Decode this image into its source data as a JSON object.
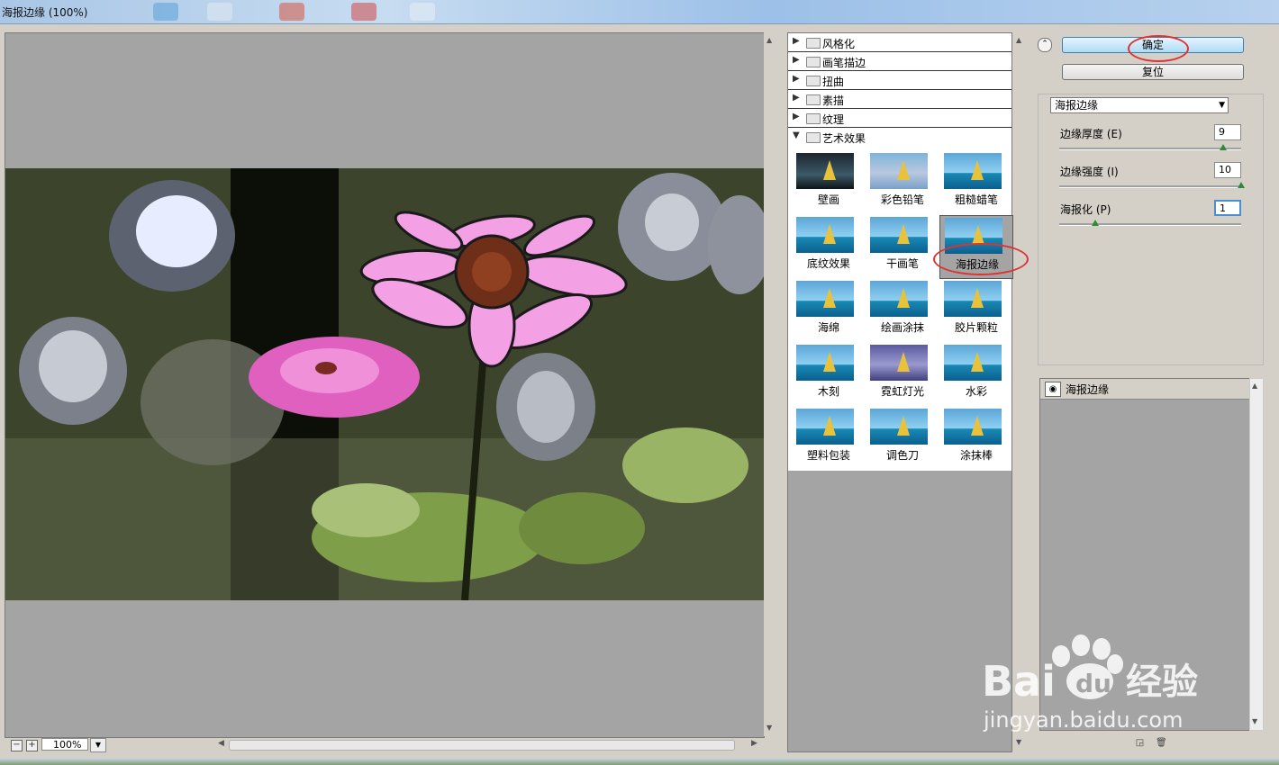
{
  "window": {
    "title": "海报边缘 (100%)"
  },
  "preview": {
    "zoom": "100%"
  },
  "gallery": {
    "categories": [
      {
        "label": "风格化",
        "expanded": false
      },
      {
        "label": "画笔描边",
        "expanded": false
      },
      {
        "label": "扭曲",
        "expanded": false
      },
      {
        "label": "素描",
        "expanded": false
      },
      {
        "label": "纹理",
        "expanded": false
      },
      {
        "label": "艺术效果",
        "expanded": true
      }
    ],
    "filters": [
      "壁画",
      "彩色铅笔",
      "粗糙蜡笔",
      "底纹效果",
      "干画笔",
      "海报边缘",
      "海绵",
      "绘画涂抹",
      "胶片颗粒",
      "木刻",
      "霓虹灯光",
      "水彩",
      "塑料包装",
      "调色刀",
      "涂抹棒"
    ],
    "selected": "海报边缘"
  },
  "buttons": {
    "ok": "确定",
    "reset": "复位"
  },
  "settings": {
    "filter": "海报边缘",
    "params": [
      {
        "label": "边缘厚度 (E)",
        "value": "9",
        "level": 0.9
      },
      {
        "label": "边缘强度 (I)",
        "value": "10",
        "level": 1.0
      },
      {
        "label": "海报化 (P)",
        "value": "1",
        "level": 0.2
      }
    ]
  },
  "layers": [
    {
      "label": "海报边缘"
    }
  ],
  "watermark": {
    "logo": "Baidu经验",
    "url": "jingyan.baidu.com"
  },
  "colors": {
    "annotation": "#dd3333",
    "slider_thumb": "#2f8a3a",
    "ok_button": "#aedcf6"
  },
  "icons": [
    "eye-icon",
    "folder-icon",
    "new-layer-icon",
    "delete-layer-icon",
    "collapse-icon"
  ]
}
